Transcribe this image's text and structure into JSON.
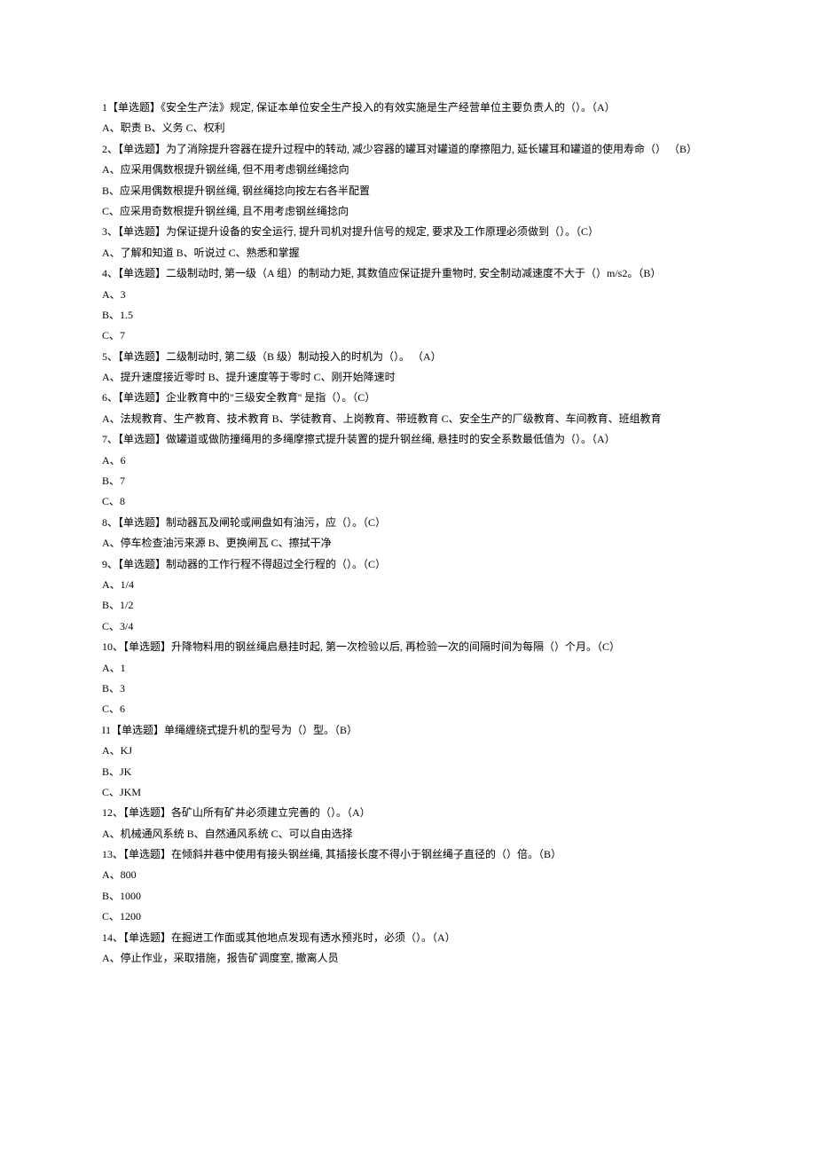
{
  "lines": [
    "1【单选题】《安全生产法》规定, 保证本单位安全生产投入的有效实施是生产经营单位主要负责人的（）。（A）",
    "A、职责 B、义务 C、权利",
    "2、【单选题】为了消除提升容器在提升过程中的转动, 减少容器的罐耳对罐道的摩擦阻力, 延长罐耳和罐道的使用寿命（） （B）",
    "A、应采用偶数根提升钢丝绳, 但不用考虑钢丝绳捻向",
    "B、应采用偶数根提升钢丝绳, 钢丝绳捻向按左右各半配置",
    "C、应采用奇数根提升钢丝绳, 且不用考虑钢丝绳捻向",
    "3、【单选题】为保证提升设备的安全运行, 提升司机对提升信号的规定, 要求及工作原理必须做到（）。（C）",
    "A、了解和知道 B、听说过 C、熟悉和掌握",
    "4、【单选题】二级制动时, 第一级（A 组）的制动力矩, 其数值应保证提升重物时, 安全制动减速度不大于（）m/s2。（B）",
    "A、3",
    "B、1.5",
    "C、7",
    "5、【单选题】二级制动时, 第二级（B 级）制动投入的时机为（）。 （A）",
    "A、提升速度接近零时 B、提升速度等于零时 C、刚开始降速时",
    "6、【单选题】企业教育中的\"三级安全教育'' 是指（）。（C）",
    "A、法规教育、生产教育、技术教育 B、学徒教育、上岗教育、带班教育 C、安全生产的厂级教育、车间教育、班组教育",
    "7、【单选题】做罐道或做防撞绳用的多绳摩擦式提升装置的提升钢丝绳, 悬挂时的安全系数最低值为（）。（A）",
    "A、6",
    "B、7",
    "C、8",
    "8、【单选题】制动器瓦及闸轮或闸盘如有油污，应（）。（C）",
    "A、停车检查油污来源 B、更换闸瓦 C、擦拭干净",
    "9、【单选题】制动器的工作行程不得超过全行程的（）。（C）",
    "A、1/4",
    "B、1/2",
    "C、3/4",
    "10、【单选题】升降物料用的钢丝绳启悬挂时起, 第一次检验以后, 再检验一次的间隔时间为每隔（）个月。（C）",
    "A、1",
    "B、3",
    "C、6",
    "I1【单选题】单绳缠绕式提升机的型号为（）型。（B）",
    "A、KJ",
    "B、JK",
    "C、JKM",
    "12、【单选题】各矿山所有矿井必须建立完善的（）。（A）",
    "A、机械通风系统 B、自然通风系统 C、可以自由选择",
    "13、【单选题】在倾斜井巷中使用有接头钢丝绳, 其插接长度不得小于钢丝绳子直径的（）倍。（B）",
    "A、800",
    "B、1000",
    "C、1200",
    "14、【单选题】在掘进工作面或其他地点发现有透水预兆时，必须（）。（A）",
    "A、停止作业，采取措施，报告矿调度室, 撤离人员"
  ]
}
